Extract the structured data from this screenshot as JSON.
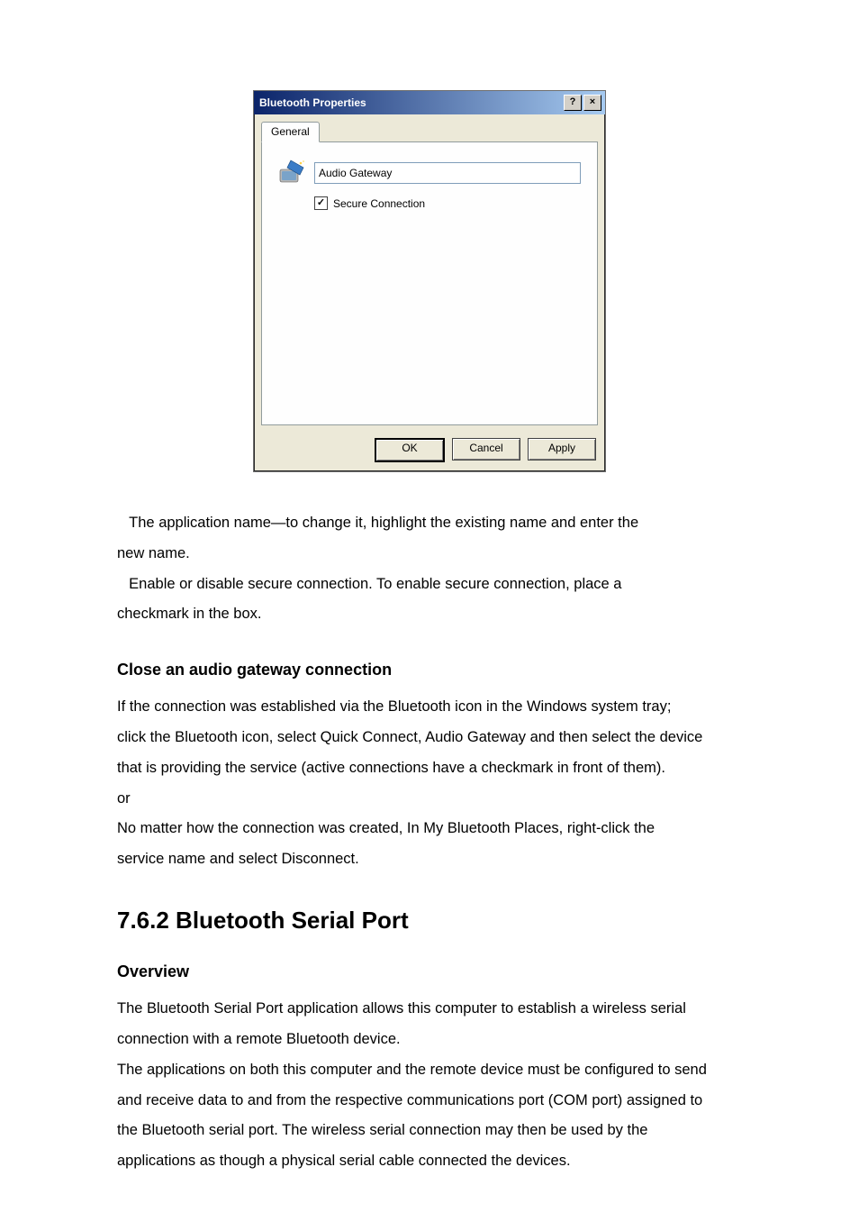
{
  "dialog": {
    "title": "Bluetooth Properties",
    "help_btn": "?",
    "close_btn": "×",
    "tab_label": "General",
    "name_value": "Audio Gateway",
    "secure_label": "Secure Connection",
    "secure_checked": true,
    "check_mark": "✓",
    "buttons": {
      "ok": "OK",
      "cancel": "Cancel",
      "apply": "Apply"
    }
  },
  "body": {
    "bullet1_a": "The application name—to change it, highlight the existing name and enter the",
    "bullet1_b": "new name.",
    "bullet2_a": "Enable or disable secure connection. To enable secure connection, place a",
    "bullet2_b": "checkmark in the box.",
    "close_heading": "Close an audio gateway connection",
    "close_p1": "If the connection was established via the Bluetooth icon in the Windows system tray;",
    "close_p2": "click the Bluetooth icon, select Quick Connect, Audio Gateway and then select the device",
    "close_p3": "that is providing the service (active connections have a checkmark in front of them).",
    "close_p4": "or",
    "close_p5": "No matter how the connection was created, In My Bluetooth Places, right-click the",
    "close_p6": "service name and select Disconnect.",
    "section_heading": "7.6.2 Bluetooth Serial Port",
    "overview_heading": "Overview",
    "ov_p1": "The Bluetooth Serial Port application allows this computer to establish a wireless serial",
    "ov_p2": "connection with a remote Bluetooth device.",
    "ov_p3": "The applications on both this computer and the remote device must be configured to send",
    "ov_p4": "and receive data to and from the respective communications port (COM port) assigned to",
    "ov_p5": "the Bluetooth serial port. The wireless serial connection may then be used by the",
    "ov_p6": "applications as though a physical serial cable connected the devices."
  }
}
